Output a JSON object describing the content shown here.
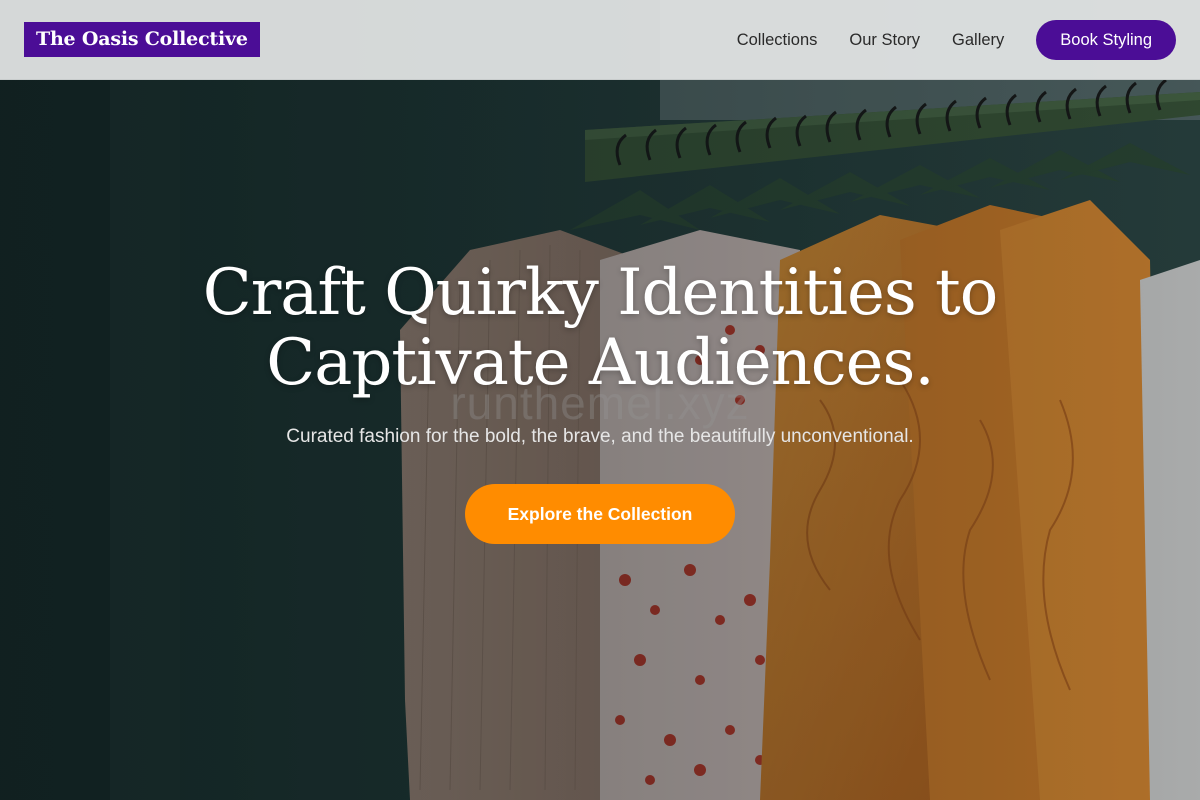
{
  "header": {
    "logo": "The Oasis Collective",
    "nav": [
      {
        "label": "Collections"
      },
      {
        "label": "Our Story"
      },
      {
        "label": "Gallery"
      }
    ],
    "cta": "Book Styling"
  },
  "hero": {
    "title_line1": "Craft Quirky Identities to",
    "title_line2": "Captivate Audiences.",
    "subtitle": "Curated fashion for the bold, the brave, and the beautifully unconventional.",
    "cta": "Explore the Collection",
    "watermark": "runthemel.xyz",
    "background_image": "clothing-rack-photo"
  },
  "colors": {
    "brand_purple": "#4b0d96",
    "accent_orange": "#ff8c00",
    "header_bg": "#e4e6e6",
    "hero_overlay": "#1f3a3a"
  }
}
